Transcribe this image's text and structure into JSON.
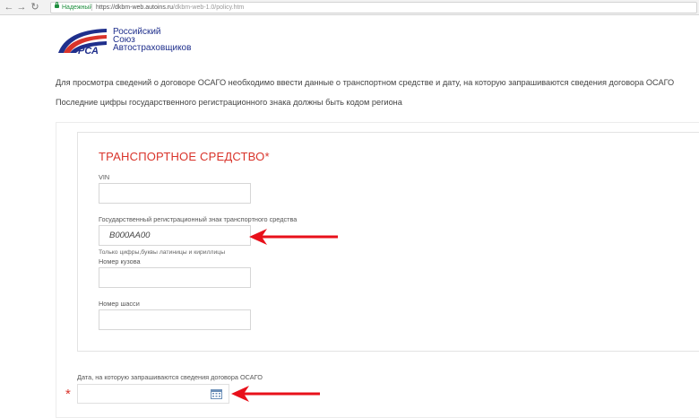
{
  "browser": {
    "back_icon": "back-arrow-icon",
    "forward_icon": "forward-arrow-icon",
    "reload_icon": "reload-icon",
    "secure_label": "Надежный",
    "url_host": "https://dkbm-web.autoins.ru",
    "url_path": "/dkbm-web-1.0/policy.htm"
  },
  "logo": {
    "line1": "Российский",
    "line2": "Союз",
    "line3": "Автостраховщиков",
    "mark_text": "РСА"
  },
  "intro": {
    "line1": "Для просмотра сведений о договоре ОСАГО необходимо ввести данные о транспортном средстве и дату, на которую запрашиваются сведения договора ОСАГО",
    "line2": "Последние цифры государственного регистрационного знака должны быть кодом региона"
  },
  "vehicle": {
    "title": "ТРАНСПОРТНОЕ СРЕДСТВО*",
    "vin_label": "VIN",
    "vin_value": "",
    "plate_label": "Государственный регистрационный знак транспортного средства",
    "plate_value": "В000АА00",
    "plate_hint": "Только цифры,буквы латиницы и кириллицы",
    "body_label": "Номер кузова",
    "body_value": "",
    "chassis_label": "Номер шасси",
    "chassis_value": ""
  },
  "date": {
    "label": "Дата, на которую запрашиваются сведения договора ОСАГО",
    "required_mark": "*",
    "value": "",
    "icon": "calendar-icon"
  },
  "colors": {
    "accent_red": "#d9342b",
    "arrow_red": "#e8101a",
    "brand_blue": "#1f2f8c"
  }
}
